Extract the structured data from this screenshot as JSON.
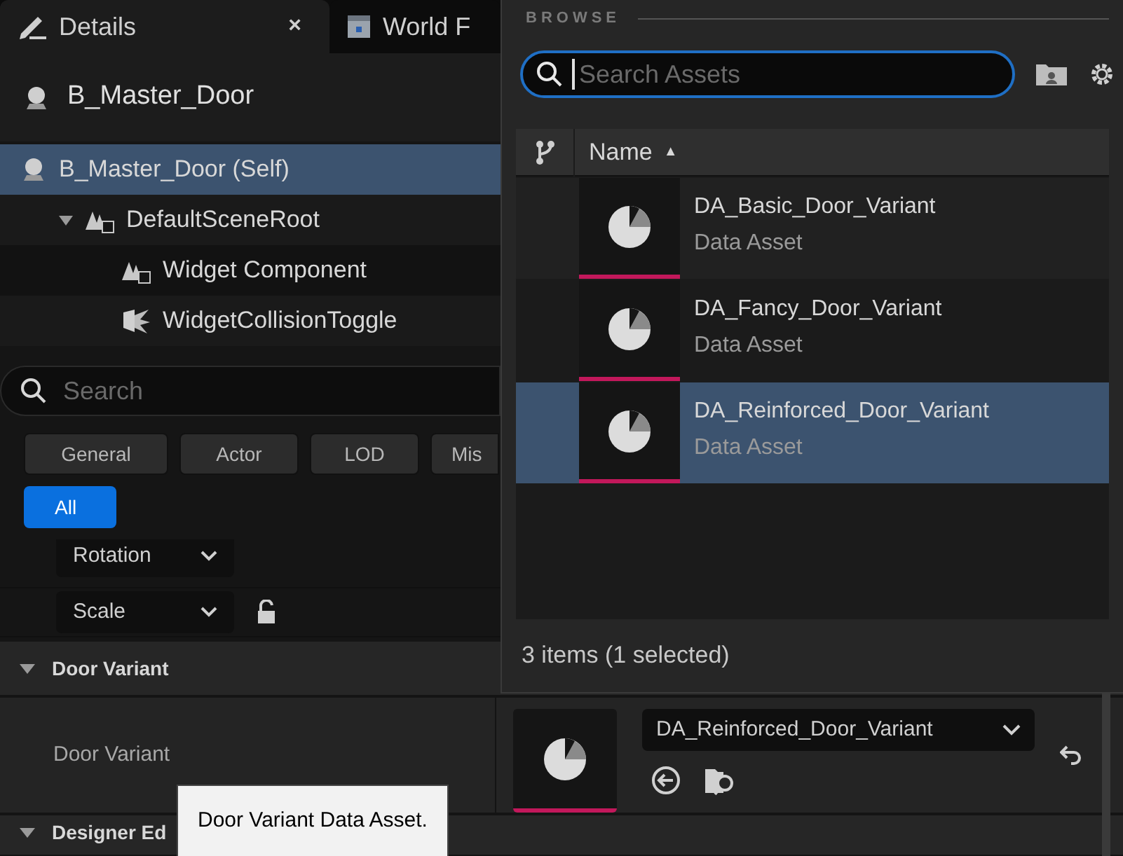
{
  "tabs": [
    {
      "label": "Details",
      "selected": true,
      "close": "×",
      "kind": "details"
    },
    {
      "label": "World F",
      "selected": false,
      "kind": "world"
    }
  ],
  "actor": {
    "name": "B_Master_Door"
  },
  "components": [
    {
      "label": "B_Master_Door (Self)",
      "kind": "actor",
      "selected": true,
      "children": [
        {
          "label": "DefaultSceneRoot",
          "kind": "scene",
          "selected": false,
          "expanded": true,
          "children": [
            {
              "label": "Widget Component",
              "kind": "scene",
              "selected": false
            },
            {
              "label": "WidgetCollisionToggle",
              "kind": "burst",
              "selected": false
            }
          ]
        }
      ]
    }
  ],
  "search": {
    "placeholder": "Search"
  },
  "filters": [
    {
      "label": "General",
      "selected": false
    },
    {
      "label": "Actor",
      "selected": false
    },
    {
      "label": "LOD",
      "selected": false
    },
    {
      "label": "Mis",
      "selected": false
    },
    {
      "label": "All",
      "selected": true
    }
  ],
  "transform_rows": [
    {
      "label": "Rotation"
    },
    {
      "label": "Scale",
      "locked": false
    }
  ],
  "categories": [
    {
      "title": "Door Variant",
      "expanded": true,
      "properties": [
        {
          "label": "Door Variant",
          "value": "DA_Reinforced_Door_Variant"
        }
      ]
    },
    {
      "title": "Designer Ed",
      "expanded": true
    }
  ],
  "tooltip": {
    "text": "Door Variant Data Asset."
  },
  "picker": {
    "section": "BROWSE",
    "search": {
      "placeholder": "Search Assets"
    },
    "column": "Name",
    "sort_indicator": "▲",
    "assets": [
      {
        "name": "DA_Basic_Door_Variant",
        "type": "Data Asset",
        "selected": false
      },
      {
        "name": "DA_Fancy_Door_Variant",
        "type": "Data Asset",
        "selected": false
      },
      {
        "name": "DA_Reinforced_Door_Variant",
        "type": "Data Asset",
        "selected": true
      }
    ],
    "status": "3 items (1 selected)"
  }
}
